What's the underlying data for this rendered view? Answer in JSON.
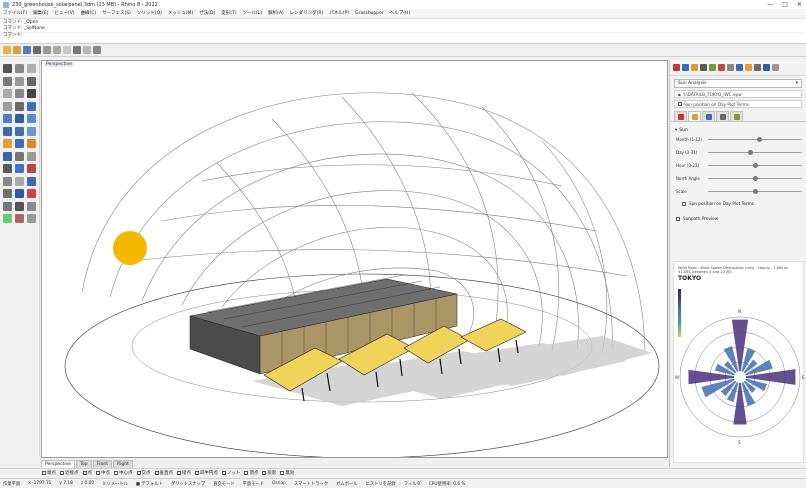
{
  "window": {
    "title": "230_greenhouse_solarpanel.3dm (13 MB) - Rhino 8 - 2022",
    "controls": [
      "—",
      "□",
      "✕"
    ]
  },
  "menu": [
    "ファイル(F)",
    "編集(E)",
    "ビュー(V)",
    "曲線(C)",
    "サーフェス(S)",
    "ソリッド(O)",
    "メッシュ(M)",
    "寸法(D)",
    "変形(T)",
    "ツール(L)",
    "解析(A)",
    "レンダリング(R)",
    "パネル(P)",
    "Grasshopper",
    "ヘルプ(H)"
  ],
  "cmdline": {
    "history1": "コマンド: _Open",
    "history2": "コマンド: _SelNone",
    "prompt": "コマンド:"
  },
  "viewport": {
    "label": "Perspective",
    "tabs": [
      "Perspective",
      "Top",
      "Front",
      "Right"
    ],
    "active_tab": "Perspective"
  },
  "osnap": [
    "端点",
    "近接点",
    "点",
    "中点",
    "中心点",
    "交点",
    "垂直点",
    "接点",
    "四半円点",
    "ノット",
    "頂点",
    "投影",
    "無効"
  ],
  "status": {
    "cplane": "作業平面",
    "x": "x -1797.71",
    "y": "y 7.18",
    "z": "z 0.00",
    "units": "ミリメートル",
    "layer": "■ デフォルト",
    "items": [
      "グリッドスナップ",
      "直交モード",
      "平面モード",
      "Osnap",
      "スマートトラック",
      "ガムボール",
      "ヒストリを記録",
      "フィルタ",
      "CPU使用率: 0.6 %"
    ]
  },
  "panel": {
    "view_dropdown": "Sun Analysis",
    "path": "Y:\\DATA\\LB_TOKYO_IWC.epw",
    "sun_checkbox": "Sun position on Day Plot Terms",
    "preview_checkbox": "Sunpath Preview",
    "section_label": "Sun",
    "sliders": [
      {
        "label": "Month (1-12)",
        "value": 0.55
      },
      {
        "label": "Day (1-31)",
        "value": 0.45
      },
      {
        "label": "Hour (0-23)",
        "value": 0.5
      },
      {
        "label": "North Angle",
        "value": 0.5
      },
      {
        "label": "Scale",
        "value": 0.5
      }
    ],
    "preview_title": "Wind Rose - Wind Speed Distribution (m/s) - Hourly - 1 JAN to 31 DEC between 0 and 23 @1",
    "preview_city": "TOKYO",
    "compass": [
      "N",
      "E",
      "S",
      "W"
    ]
  },
  "colors": {
    "sun": "#f5b800",
    "panel_fill": "#f2d35a",
    "windrose_dark": "#4a2f7e",
    "windrose_blue": "#3f6db0",
    "accent": "#2b579a"
  }
}
